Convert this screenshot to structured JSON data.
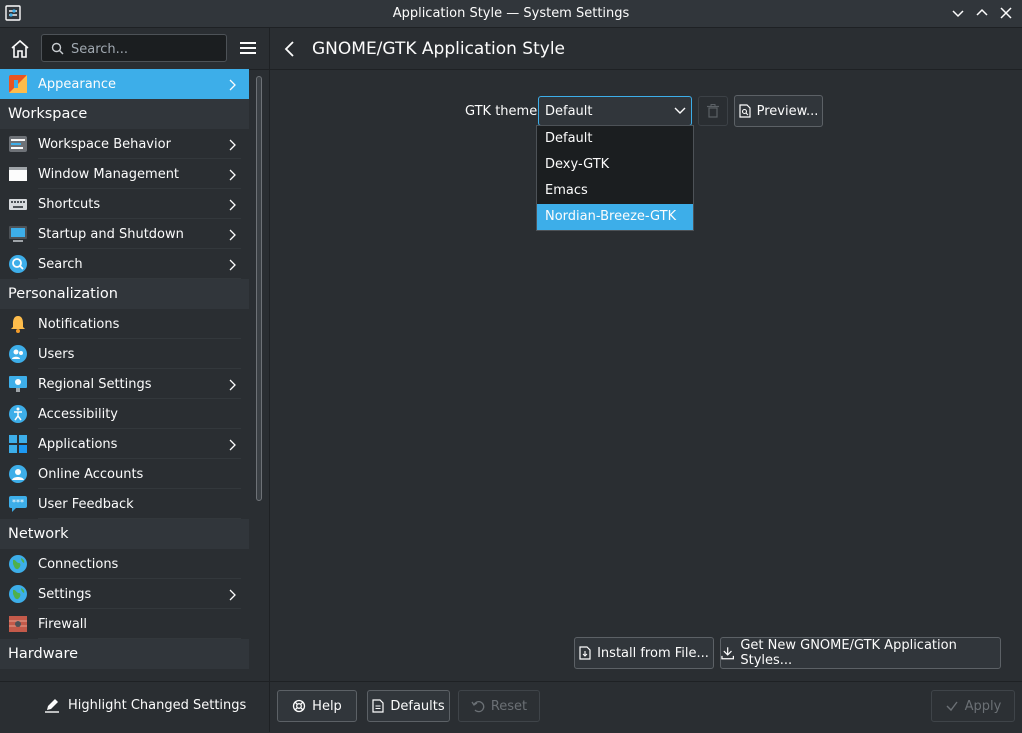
{
  "window": {
    "title": "Application Style — System Settings"
  },
  "sidebar": {
    "search_placeholder": "Search...",
    "items": [
      {
        "type": "item",
        "label": "Appearance",
        "selected": true,
        "arrow": true,
        "icon": "appearance-icon"
      },
      {
        "type": "category",
        "label": "Workspace"
      },
      {
        "type": "item",
        "label": "Workspace Behavior",
        "arrow": true,
        "icon": "workspace-behavior-icon"
      },
      {
        "type": "item",
        "label": "Window Management",
        "arrow": true,
        "icon": "window-management-icon"
      },
      {
        "type": "item",
        "label": "Shortcuts",
        "arrow": true,
        "icon": "keyboard-icon"
      },
      {
        "type": "item",
        "label": "Startup and Shutdown",
        "arrow": true,
        "icon": "startup-icon"
      },
      {
        "type": "item",
        "label": "Search",
        "arrow": true,
        "icon": "search-icon"
      },
      {
        "type": "category",
        "label": "Personalization"
      },
      {
        "type": "item",
        "label": "Notifications",
        "arrow": false,
        "icon": "bell-icon"
      },
      {
        "type": "item",
        "label": "Users",
        "arrow": false,
        "icon": "users-icon"
      },
      {
        "type": "item",
        "label": "Regional Settings",
        "arrow": true,
        "icon": "regional-icon"
      },
      {
        "type": "item",
        "label": "Accessibility",
        "arrow": false,
        "icon": "accessibility-icon"
      },
      {
        "type": "item",
        "label": "Applications",
        "arrow": true,
        "icon": "applications-icon"
      },
      {
        "type": "item",
        "label": "Online Accounts",
        "arrow": false,
        "icon": "online-accounts-icon"
      },
      {
        "type": "item",
        "label": "User Feedback",
        "arrow": false,
        "icon": "feedback-icon"
      },
      {
        "type": "category",
        "label": "Network"
      },
      {
        "type": "item",
        "label": "Connections",
        "arrow": false,
        "icon": "globe-icon"
      },
      {
        "type": "item",
        "label": "Settings",
        "arrow": true,
        "icon": "globe-icon"
      },
      {
        "type": "item",
        "label": "Firewall",
        "arrow": false,
        "icon": "firewall-icon"
      },
      {
        "type": "category",
        "label": "Hardware"
      }
    ],
    "highlight_label": "Highlight Changed Settings"
  },
  "main": {
    "title": "GNOME/GTK Application Style",
    "gtk_label": "GTK theme:",
    "combo_value": "Default",
    "preview_label": "Preview...",
    "dropdown_options": [
      "Default",
      "Dexy-GTK",
      "Emacs",
      "Nordian-Breeze-GTK"
    ],
    "dropdown_selected": "Nordian-Breeze-GTK",
    "install_label": "Install from File...",
    "getnew_label": "Get New GNOME/GTK Application Styles...",
    "help_label": "Help",
    "defaults_label": "Defaults",
    "reset_label": "Reset",
    "apply_label": "Apply"
  },
  "colors": {
    "accent": "#3daee9",
    "background": "#2a2e32",
    "header": "#31363b"
  }
}
